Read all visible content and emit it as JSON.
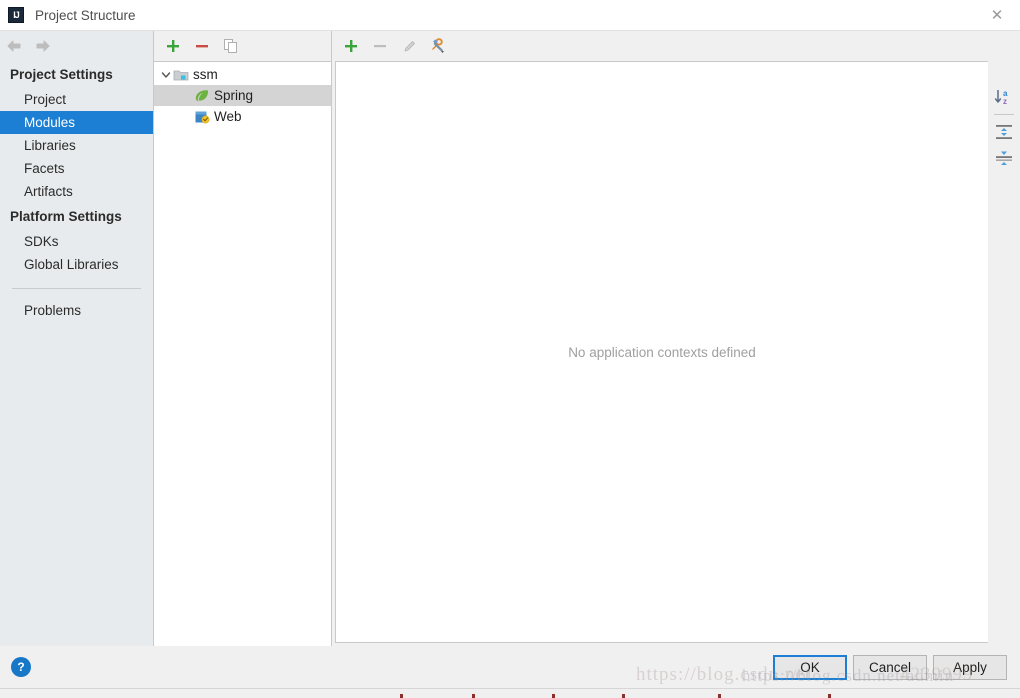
{
  "window": {
    "title": "Project Structure",
    "logo_text": "IJ",
    "close_icon": "close-icon"
  },
  "nav": {
    "back_icon": "arrow-left-icon",
    "forward_icon": "arrow-right-icon"
  },
  "sidebar": {
    "groups": [
      {
        "heading": "Project Settings",
        "items": [
          {
            "label": "Project",
            "selected": false
          },
          {
            "label": "Modules",
            "selected": true
          },
          {
            "label": "Libraries",
            "selected": false
          },
          {
            "label": "Facets",
            "selected": false
          },
          {
            "label": "Artifacts",
            "selected": false
          }
        ]
      },
      {
        "heading": "Platform Settings",
        "items": [
          {
            "label": "SDKs",
            "selected": false
          },
          {
            "label": "Global Libraries",
            "selected": false
          }
        ]
      }
    ],
    "problems_label": "Problems",
    "selected_color": "#1c7fd3"
  },
  "tree_toolbar": {
    "buttons": [
      {
        "name": "add-module-button",
        "icon": "plus-icon",
        "enabled": true
      },
      {
        "name": "remove-module-button",
        "icon": "minus-icon",
        "enabled": true
      },
      {
        "name": "copy-module-button",
        "icon": "copy-icon",
        "enabled": false
      }
    ]
  },
  "module_tree": {
    "nodes": [
      {
        "label": "ssm",
        "icon": "module-folder-icon",
        "depth": 0,
        "expanded": true,
        "has_toggle": true,
        "selected": false
      },
      {
        "label": "Spring",
        "icon": "spring-leaf-icon",
        "depth": 1,
        "expanded": false,
        "has_toggle": false,
        "selected": true
      },
      {
        "label": "Web",
        "icon": "web-facet-icon",
        "depth": 1,
        "expanded": false,
        "has_toggle": false,
        "selected": false
      }
    ]
  },
  "detail_toolbar": {
    "buttons": [
      {
        "name": "add-context-button",
        "icon": "plus-icon",
        "enabled": true
      },
      {
        "name": "remove-context-button",
        "icon": "minus-icon",
        "enabled": false
      },
      {
        "name": "edit-context-button",
        "icon": "pencil-icon",
        "enabled": false
      },
      {
        "name": "configure-button",
        "icon": "wrench-dropdown-icon",
        "enabled": true
      }
    ]
  },
  "detail": {
    "empty_message": "No application contexts defined"
  },
  "side_toolbar": {
    "buttons": [
      {
        "name": "sort-alphabetically-button",
        "icon": "sort-az-icon"
      },
      {
        "name": "expand-all-button",
        "icon": "expand-all-icon"
      },
      {
        "name": "collapse-all-button",
        "icon": "collapse-all-icon"
      }
    ]
  },
  "footer": {
    "help_icon_label": "?",
    "buttons": [
      {
        "label": "OK",
        "name": "ok-button",
        "default": true
      },
      {
        "label": "Cancel",
        "name": "cancel-button",
        "default": false
      },
      {
        "label": "Apply",
        "name": "apply-button",
        "default": false
      }
    ]
  },
  "watermark": {
    "part_a": "https://blog.csdn.net",
    "part_b": "https://blog.csdn.net/admin",
    "part_c": "4239999"
  }
}
